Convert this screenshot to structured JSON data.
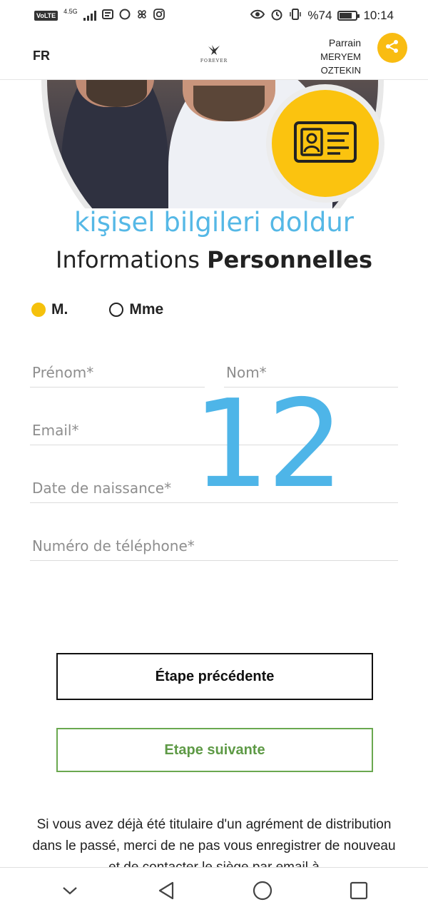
{
  "status_bar": {
    "volte": "VoLTE",
    "network": "4.5G",
    "battery_pct": "%74",
    "battery_level": 0.74,
    "time": "10:14"
  },
  "header": {
    "language": "FR",
    "logo_text": "FOREVER",
    "sponsor_title": "Parrain",
    "sponsor_first": "MERYEM",
    "sponsor_last": "OZTEKIN",
    "icons": {
      "share": "share-icon"
    }
  },
  "hero": {
    "badge_icon": "id-card-icon"
  },
  "headings": {
    "subtitle_tr": "kişisel bilgileri doldur",
    "title_regular": "Informations",
    "title_bold": "Personnelles"
  },
  "step_number": "12",
  "gender": {
    "options": [
      {
        "label": "M.",
        "checked": true
      },
      {
        "label": "Mme",
        "checked": false
      }
    ]
  },
  "form": {
    "first_name_placeholder": "Prénom*",
    "last_name_placeholder": "Nom*",
    "email_placeholder": "Email*",
    "birthdate_placeholder": "Date de naissance*",
    "phone_placeholder": "Numéro de téléphone*"
  },
  "buttons": {
    "prev": "Étape précédente",
    "next": "Etape suivante"
  },
  "notice": "Si vous avez déjà été titulaire d'un agrément de distribution dans le passé, merci de ne pas vous enregistrer de nouveau et de contacter le siège par email à",
  "colors": {
    "accent_yellow": "#f9bc12",
    "accent_blue": "#55b8e6",
    "next_green": "#6aa84f"
  }
}
